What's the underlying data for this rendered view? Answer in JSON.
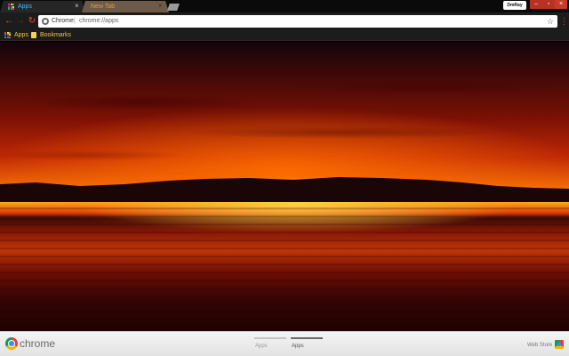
{
  "tabs": [
    {
      "label": "Apps",
      "close": "×"
    },
    {
      "label": "New Tab",
      "close": "×"
    }
  ],
  "window": {
    "profile_label": "DmRay",
    "minimize": "–",
    "maximize": "▫",
    "close": "×"
  },
  "toolbar": {
    "back": "←",
    "forward": "→",
    "reload": "↻",
    "omnibox_scheme": "Chrome",
    "omnibox_separator": "|",
    "omnibox_url": "chrome://apps",
    "star": "☆",
    "menu": "⋮"
  },
  "bookmarks": {
    "apps_label": "Apps",
    "folder_label": "Bookmarks"
  },
  "bottom": {
    "brand": "chrome",
    "pages": [
      "Apps",
      "Apps"
    ],
    "webstore": "Web Store"
  },
  "colors": {
    "accent": "#ff4a2e",
    "active_tab_text": "#29c4ff",
    "bookmark_text": "#f0c24a",
    "apps_grid": [
      "#e53935",
      "#fdd835",
      "#43a047",
      "#1e88e5",
      "#e53935",
      "#fdd835",
      "#43a047",
      "#1e88e5",
      "#e53935"
    ]
  },
  "icons": {
    "apps": "apps-grid-icon",
    "folder": "folder-icon",
    "back": "back-arrow-icon",
    "forward": "forward-arrow-icon",
    "reload": "reload-icon",
    "star": "star-icon",
    "menu": "menu-icon",
    "page": "chrome-page-icon",
    "brand": "chrome-logo-icon",
    "webstore": "webstore-icon"
  }
}
